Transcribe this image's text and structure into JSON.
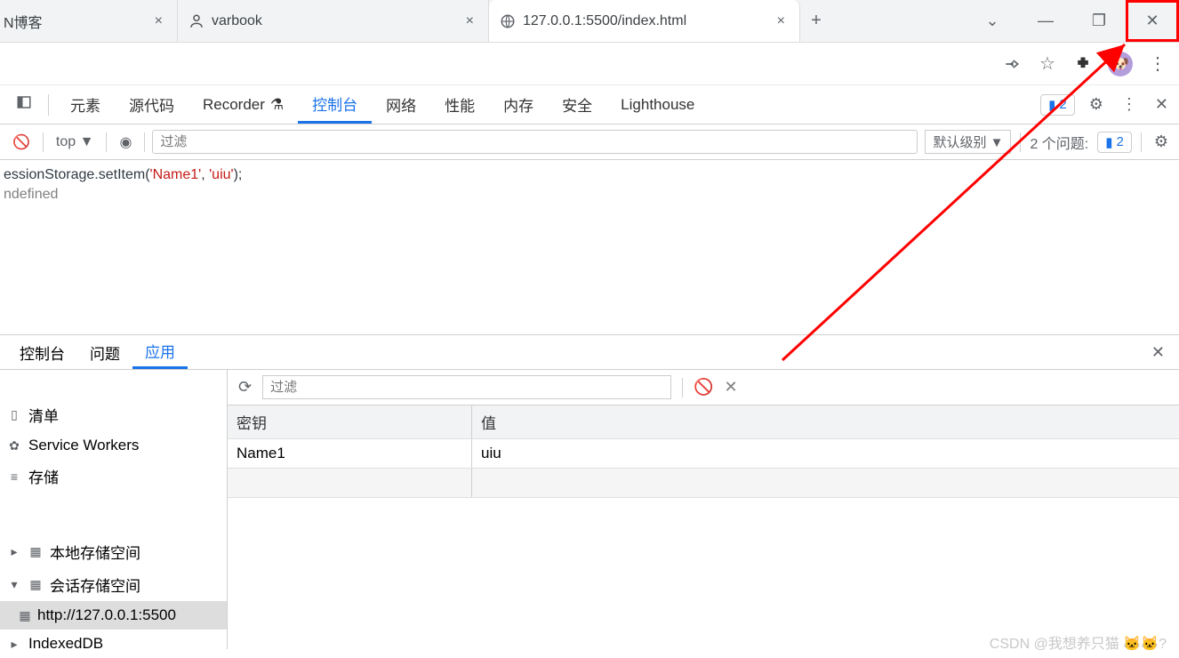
{
  "tabs": [
    {
      "title": "N博客"
    },
    {
      "title": "varbook"
    },
    {
      "title": "127.0.0.1:5500/index.html"
    }
  ],
  "dev": {
    "tabs": [
      "元素",
      "源代码",
      "Recorder",
      "控制台",
      "网络",
      "性能",
      "内存",
      "安全",
      "Lighthouse"
    ],
    "issueCount": "2",
    "filterPlaceholder": "过滤",
    "topLabel": "top ▼",
    "levelLabel": "默认级别 ▼",
    "issueText": "2 个问题:",
    "issueBadgeCount": "2"
  },
  "consoleLines": {
    "cmd_prefix": "essionStorage.setItem(",
    "arg1": "'Name1'",
    "sep": ", ",
    "arg2": "'uiu'",
    "suffix": ");",
    "result": "ndefined"
  },
  "drawer": {
    "tabs": [
      "控制台",
      "问题",
      "应用"
    ]
  },
  "appSidebar": {
    "manifest": "清单",
    "sw": "Service Workers",
    "storage": "存储",
    "localStorage": "本地存储空间",
    "sessionStorage": "会话存储空间",
    "origin": "http://127.0.0.1:5500",
    "indexeddb": "IndexedDB"
  },
  "appToolbar": {
    "filterPlaceholder": "过滤"
  },
  "kvTable": {
    "keyHeader": "密钥",
    "valueHeader": "值",
    "rows": [
      {
        "key": "Name1",
        "value": "uiu"
      }
    ]
  },
  "watermark": "CSDN @我想养只猫 🐱🐱?"
}
